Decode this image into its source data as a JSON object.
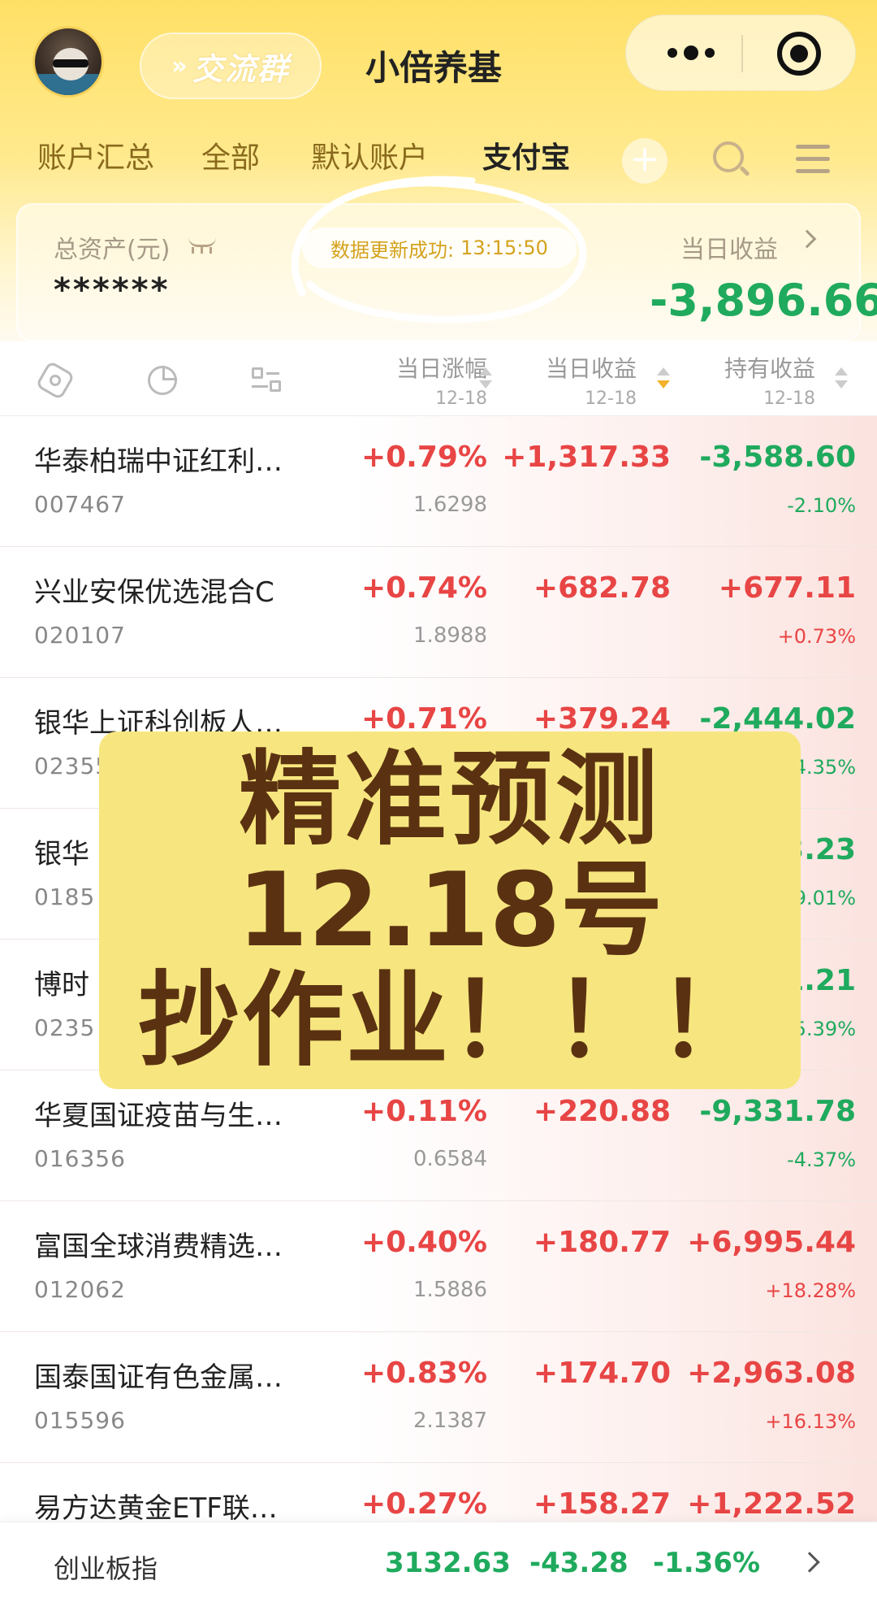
{
  "header": {
    "chat_group_arrows": "»",
    "chat_group_label": "交流群",
    "app_title": "小倍养基",
    "more_icon": "more-dots-icon",
    "close_icon": "target-close-icon"
  },
  "tabs": [
    {
      "label": "账户汇总",
      "active": false
    },
    {
      "label": "全部",
      "active": false
    },
    {
      "label": "默认账户",
      "active": false
    },
    {
      "label": "支付宝",
      "active": true
    }
  ],
  "tab_add_label": "+",
  "summary": {
    "asset_label": "总资产(元)",
    "asset_value": "******",
    "update_text": "数据更新成功:",
    "update_time": "13:15:50",
    "daily_label": "当日收益",
    "daily_value": "-3,896.66"
  },
  "columns": [
    {
      "title": "当日涨幅",
      "date": "12-18"
    },
    {
      "title": "当日收益",
      "date": "12-18"
    },
    {
      "title": "持有收益",
      "date": "12-18"
    }
  ],
  "funds": [
    {
      "name": "华泰柏瑞中证红利…",
      "code": "007467",
      "change": "+0.79%",
      "nav": "1.6298",
      "daily": "+1,317.33",
      "hold": "-3,588.60",
      "hold_pct": "-2.10%"
    },
    {
      "name": "兴业安保优选混合C",
      "code": "020107",
      "change": "+0.74%",
      "nav": "1.8988",
      "daily": "+682.78",
      "hold": "+677.11",
      "hold_pct": "+0.73%"
    },
    {
      "name": "银华上证科创板人…",
      "code": "02355",
      "change": "+0.71%",
      "nav": "",
      "daily": "+379.24",
      "hold": "-2,444.02",
      "hold_pct": "4.35%"
    },
    {
      "name": "银华",
      "code": "0185",
      "change": "",
      "nav": "",
      "daily": "",
      "hold": "3.23",
      "hold_pct": "9.01%"
    },
    {
      "name": "博时",
      "code": "0235",
      "change": "",
      "nav": "",
      "daily": "",
      "hold": "1.21",
      "hold_pct": "5.39%"
    },
    {
      "name": "华夏国证疫苗与生…",
      "code": "016356",
      "change": "+0.11%",
      "nav": "0.6584",
      "daily": "+220.88",
      "hold": "-9,331.78",
      "hold_pct": "-4.37%"
    },
    {
      "name": "富国全球消费精选…",
      "code": "012062",
      "change": "+0.40%",
      "nav": "1.5886",
      "daily": "+180.77",
      "hold": "+6,995.44",
      "hold_pct": "+18.28%"
    },
    {
      "name": "国泰国证有色金属…",
      "code": "015596",
      "change": "+0.83%",
      "nav": "2.1387",
      "daily": "+174.70",
      "hold": "+2,963.08",
      "hold_pct": "+16.13%"
    },
    {
      "name": "易方达黄金ETF联…",
      "code": "",
      "change": "+0.27%",
      "nav": "",
      "daily": "+158.27",
      "hold": "+1,222.52",
      "hold_pct": ""
    }
  ],
  "banner": {
    "line1": "精准预测",
    "line2": "12.18号",
    "line3": "抄作业！！！"
  },
  "ticker": {
    "name": "创业板指",
    "value": "3132.63",
    "change": "-43.28",
    "percent": "-1.36%"
  },
  "colors": {
    "up": "#e84545",
    "down": "#1faa5d",
    "banner_bg": "#f7e67f",
    "banner_text": "#5a3211"
  }
}
